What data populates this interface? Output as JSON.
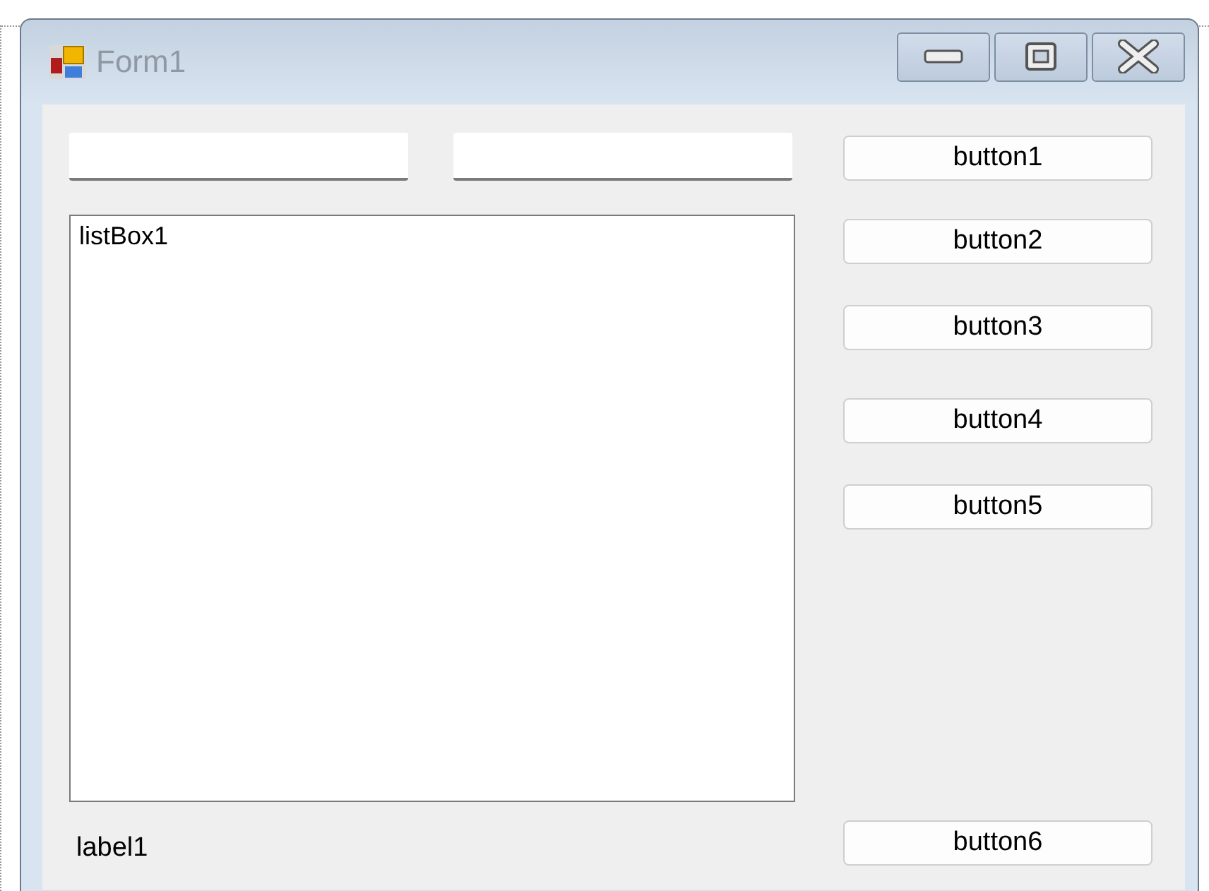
{
  "window": {
    "title": "Form1"
  },
  "text_fields": [
    {
      "kind": "textbox"
    },
    {
      "kind": "textbox"
    }
  ],
  "list_box": {
    "items": [
      "listBox1"
    ]
  },
  "label": "label1",
  "buttons": [
    "button1",
    "button2",
    "button3",
    "button4",
    "button5",
    "button6"
  ]
}
